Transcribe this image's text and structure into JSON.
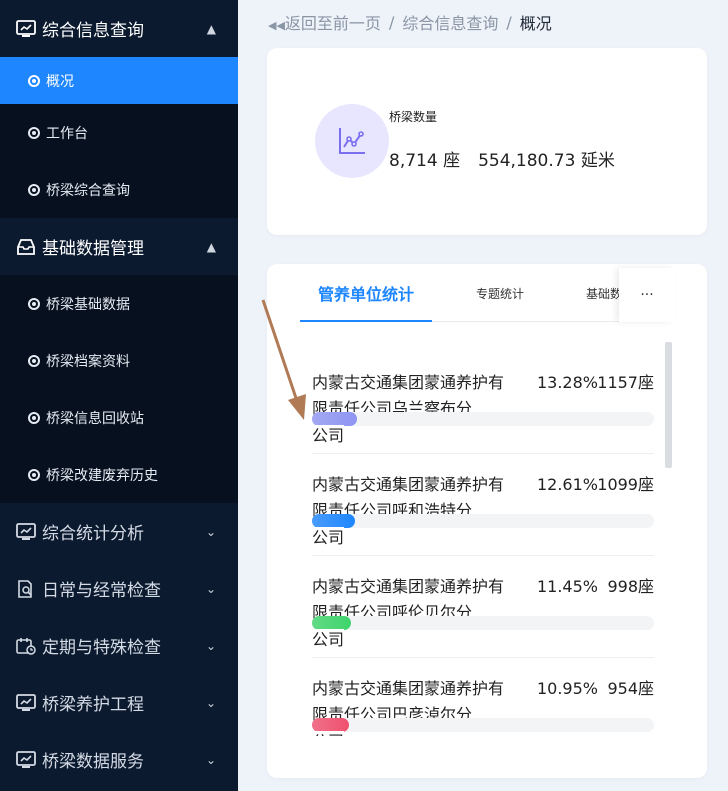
{
  "sidebar": {
    "groups": [
      {
        "label": "综合信息查询",
        "expanded": true,
        "items": [
          "概况",
          "工作台",
          "桥梁综合查询"
        ]
      },
      {
        "label": "基础数据管理",
        "expanded": true,
        "items": [
          "桥梁基础数据",
          "桥梁档案资料",
          "桥梁信息回收站",
          "桥梁改建废弃历史"
        ]
      },
      {
        "label": "综合统计分析",
        "expanded": false
      },
      {
        "label": "日常与经常检查",
        "expanded": false
      },
      {
        "label": "定期与特殊检查",
        "expanded": false
      },
      {
        "label": "桥梁养护工程",
        "expanded": false
      },
      {
        "label": "桥梁数据服务",
        "expanded": false
      }
    ],
    "active_item": "概况"
  },
  "breadcrumb": {
    "back": "返回至前一页",
    "section": "综合信息查询",
    "current": "概况",
    "separator": "/"
  },
  "summary": {
    "label": "桥梁数量",
    "count": "8,714 座",
    "length": "554,180.73 延米"
  },
  "tabs": [
    {
      "label": "管养单位统计",
      "active": true
    },
    {
      "label": "专题统计",
      "active": false
    },
    {
      "label": "基础数",
      "active": false
    }
  ],
  "tab_more": "···",
  "units": [
    {
      "name": "内蒙古交通集团蒙通养护有限责任公司乌兰察布分",
      "tail": "公司",
      "percent": "13.28%",
      "count": "1157座",
      "fill": 0.1328,
      "color": "#8f95f2"
    },
    {
      "name": "内蒙古交通集团蒙通养护有限责任公司呼和浩特分",
      "tail": "公司",
      "percent": "12.61%",
      "count": "1099座",
      "fill": 0.1261,
      "color": "#1e86ff"
    },
    {
      "name": "内蒙古交通集团蒙通养护有限责任公司呼伦贝尔分",
      "tail": "公司",
      "percent": "11.45%",
      "count": "998座",
      "fill": 0.1145,
      "color": "#3fd46b"
    },
    {
      "name": "内蒙古交通集团蒙通养护有限责任公司巴彦淖尔分",
      "tail": "公司",
      "percent": "10.95%",
      "count": "954座",
      "fill": 0.1095,
      "color": "#f0506e"
    }
  ],
  "colors": {
    "accent": "#1e86ff",
    "sidebar_bg": "#0b1a2f",
    "arrow": "#b07a55"
  }
}
